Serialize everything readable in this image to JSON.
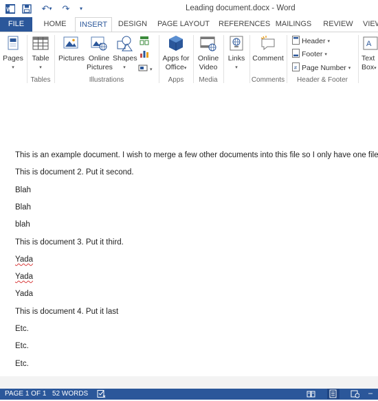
{
  "window": {
    "title": "Leading document.docx - Word"
  },
  "qat": {
    "undo": "↶",
    "undo_arrow": "▾",
    "redo": "↷",
    "customize": "▾"
  },
  "tabs": [
    "FILE",
    "HOME",
    "INSERT",
    "DESIGN",
    "PAGE LAYOUT",
    "REFERENCES",
    "MAILINGS",
    "REVIEW",
    "VIEW"
  ],
  "ribbon": {
    "pages": {
      "label": "Pages",
      "arrow": "▾"
    },
    "tables": {
      "button": "Table",
      "arrow": "▾",
      "group": "Tables"
    },
    "illustrations": {
      "pictures": "Pictures",
      "online_pictures_1": "Online",
      "online_pictures_2": "Pictures",
      "shapes": "Shapes",
      "shapes_arrow": "▾",
      "screenshot_arrow": "▾",
      "group": "Illustrations"
    },
    "apps": {
      "label_1": "Apps for",
      "label_2": "Office",
      "arrow": "▾",
      "group": "Apps"
    },
    "media": {
      "label_1": "Online",
      "label_2": "Video",
      "group": "Media"
    },
    "links": {
      "label": "Links",
      "arrow": "▾"
    },
    "comments": {
      "label": "Comment",
      "group": "Comments"
    },
    "header_footer": {
      "header": "Header",
      "footer": "Footer",
      "page_number": "Page Number",
      "arrow": "▾",
      "group": "Header & Footer"
    },
    "text": {
      "label_1": "Text",
      "label_2": "Box",
      "arrow": "▾"
    }
  },
  "document": {
    "paragraphs": [
      {
        "text": "This is an example document. I wish to merge a few other documents into this file so I only have one file.",
        "squiggle": false
      },
      {
        "text": "This is document 2. Put it second.",
        "squiggle": false
      },
      {
        "text": "Blah",
        "squiggle": false
      },
      {
        "text": "Blah",
        "squiggle": false
      },
      {
        "text": "blah",
        "squiggle": false
      },
      {
        "text": "This is document 3. Put it third.",
        "squiggle": false
      },
      {
        "text": "Yada",
        "squiggle": true
      },
      {
        "text": "Yada",
        "squiggle": true
      },
      {
        "text": "Yada",
        "squiggle": false
      },
      {
        "text": "This is document 4. Put it last",
        "squiggle": false
      },
      {
        "text": "Etc.",
        "squiggle": false
      },
      {
        "text": "Etc.",
        "squiggle": false
      },
      {
        "text": "Etc.",
        "squiggle": false
      }
    ]
  },
  "status": {
    "page": "PAGE 1 OF 1",
    "words": "52 WORDS",
    "dash": "–"
  }
}
